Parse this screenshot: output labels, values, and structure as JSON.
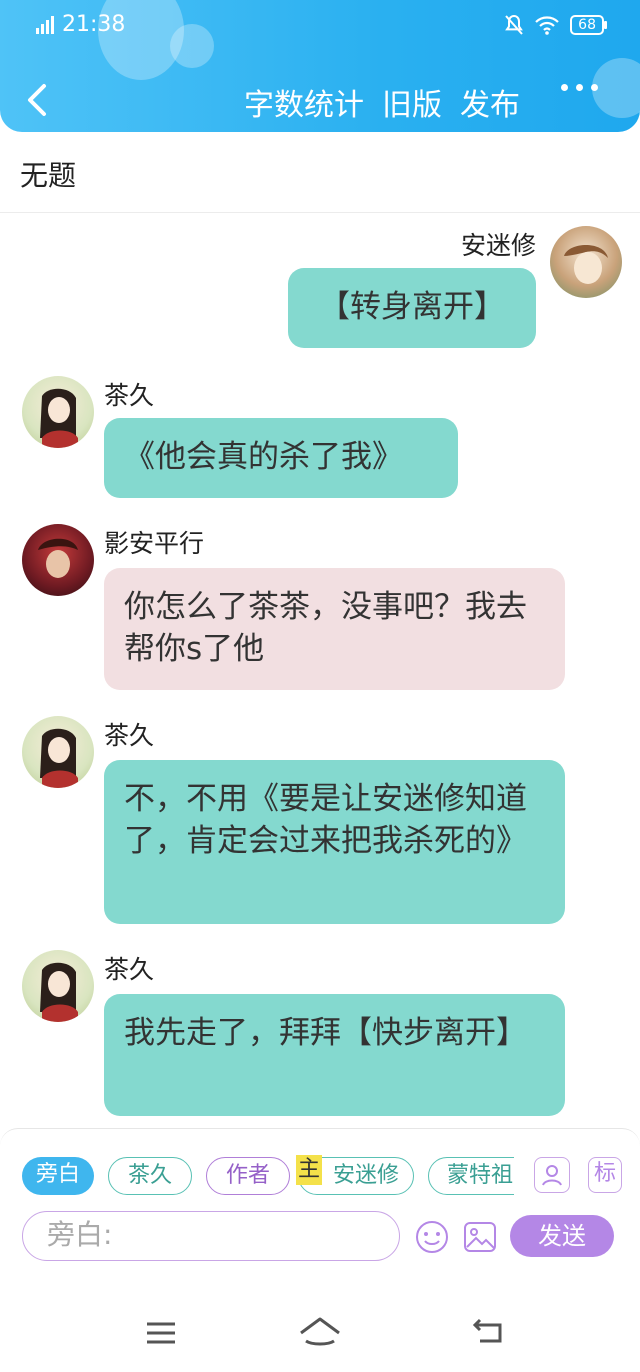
{
  "status_bar": {
    "time": "21:38",
    "battery": "68"
  },
  "header": {
    "actions": [
      "字数统计",
      "旧版",
      "发布"
    ]
  },
  "title": "无题",
  "messages": [
    {
      "sender": "安迷修",
      "side": "right",
      "text": "【转身离开】",
      "color": "teal"
    },
    {
      "sender": "茶久",
      "side": "left",
      "text": "《他会真的杀了我》",
      "color": "teal"
    },
    {
      "sender": "影安平行",
      "side": "left",
      "text": "你怎么了茶茶，没事吧？我去帮你s了他",
      "color": "pink"
    },
    {
      "sender": "茶久",
      "side": "left",
      "text": "不，不用《要是让安迷修知道了，肯定会过来把我杀死的》",
      "color": "teal"
    },
    {
      "sender": "茶久",
      "side": "left",
      "text": "我先走了，拜拜【快步离开】",
      "color": "teal"
    }
  ],
  "role_chips": [
    {
      "label": "旁白",
      "active": true
    },
    {
      "label": "茶久"
    },
    {
      "label": "作者"
    },
    {
      "label": "主",
      "tag": true
    },
    {
      "label": "安迷修"
    },
    {
      "label": "蒙特祖"
    }
  ],
  "side_icons": {
    "role_icon": "user-card-icon",
    "tag_label": "标"
  },
  "input": {
    "placeholder": "旁白:"
  },
  "send_label": "发送",
  "colors": {
    "header": "#2ab0f0",
    "teal_bubble": "#84d9cf",
    "pink_bubble": "#f2dfe1",
    "send": "#b487e6"
  }
}
